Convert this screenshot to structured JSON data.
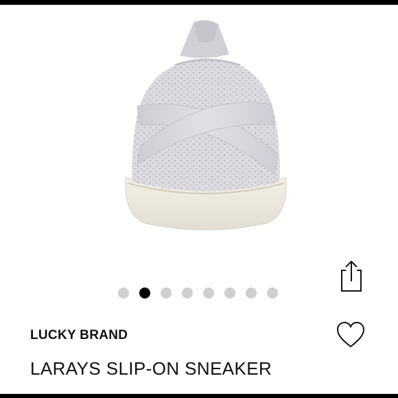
{
  "product": {
    "brand": "LUCKY BRAND",
    "name": "LARAYS SLIP-ON SNEAKER",
    "image_icon": "slip-on-sneaker",
    "color": "#d8d6da"
  },
  "carousel": {
    "total_slides": 8,
    "active_index": 1
  },
  "actions": {
    "share_icon": "share-icon",
    "favorite_icon": "heart-icon"
  }
}
